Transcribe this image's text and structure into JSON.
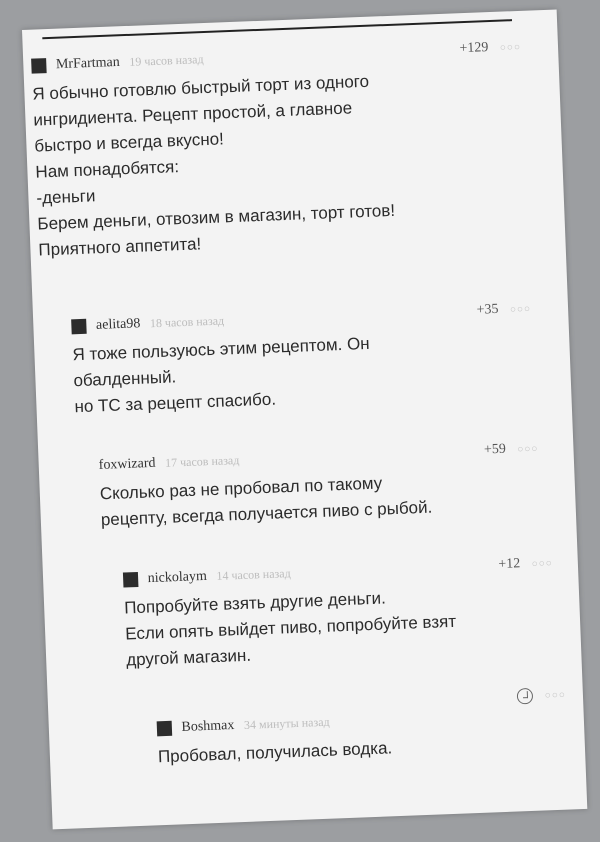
{
  "comments": [
    {
      "username": "MrFartman",
      "time": "19 часов назад",
      "score": "+129",
      "lines": [
        "Я обычно готовлю быстрый торт из одного",
        "ингридиента. Рецепт простой, а главное",
        "быстро и всегда вкусно!",
        "Нам понадобятся:",
        "-деньги",
        "Берем деньги, отвозим в магазин, торт готов!",
        "Приятного аппетита!"
      ]
    },
    {
      "username": "aelita98",
      "time": "18 часов назад",
      "score": "+35",
      "lines": [
        "Я тоже пользуюсь этим рецептом. Он",
        "обалденный.",
        "но ТС за рецепт спасибо."
      ]
    },
    {
      "username": "foxwizard",
      "time": "17 часов назад",
      "score": "+59",
      "lines": [
        "Сколько раз не пробовал по такому",
        "рецепту, всегда получается пиво с рыбой."
      ]
    },
    {
      "username": "nickolaym",
      "time": "14 часов назад",
      "score": "+12",
      "lines": [
        "Попробуйте взять другие деньги.",
        "Если опять выйдет пиво, попробуйте взят",
        "другой магазин."
      ]
    },
    {
      "username": "Boshmax",
      "time": "34 минуты назад",
      "score": "",
      "lines": [
        "Пробовал, получилась водка."
      ]
    }
  ],
  "more_icon": "ellipsis-icon",
  "reply_icon": "reply-icon"
}
